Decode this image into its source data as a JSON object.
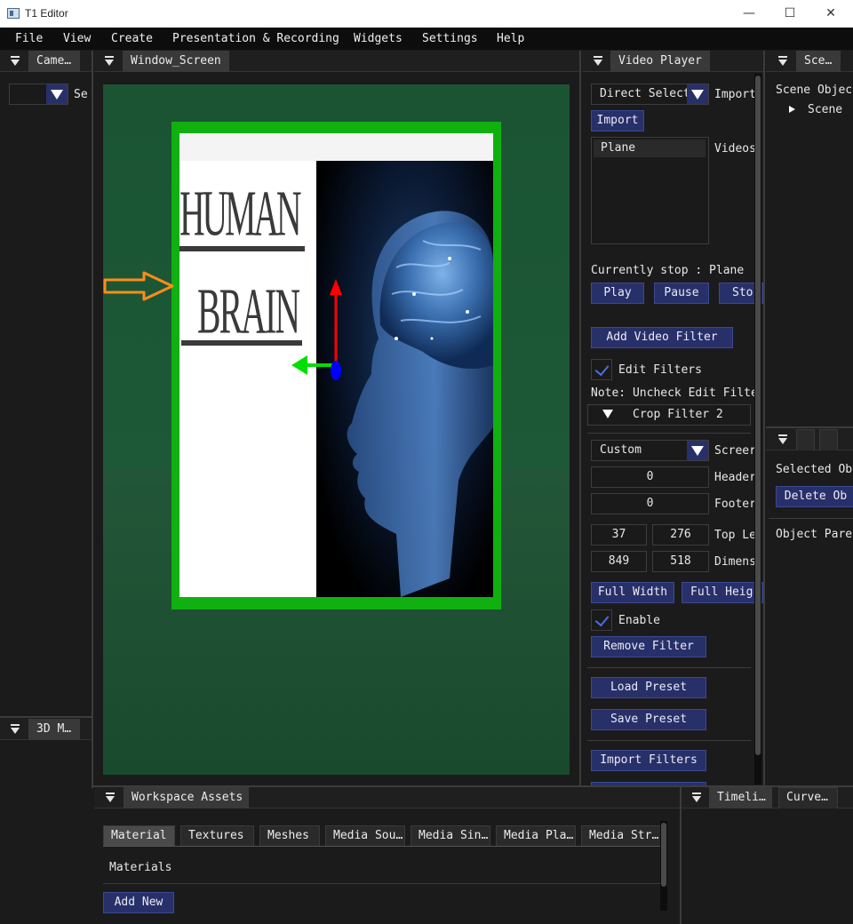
{
  "window": {
    "title": "T1 Editor",
    "minimize": "—",
    "maximize": "☐",
    "close": "✕"
  },
  "menu": [
    "File",
    "View",
    "Create",
    "Presentation & Recording",
    "Widgets",
    "Settings",
    "Help"
  ],
  "camera_panel": {
    "tab": "Came…",
    "combo_value": "",
    "label": "Se"
  },
  "model_panel": {
    "tab": "3D M…"
  },
  "viewport_panel": {
    "tab": "Window_Screen",
    "screen": {
      "title_word": "HUMAN",
      "subtitle_word": "BRAIN"
    }
  },
  "video_player": {
    "tab": "Video Player",
    "source_combo": "Direct Select",
    "import_label": "Import",
    "import_button": "Import",
    "list_items": [
      "Plane"
    ],
    "videos_label": "Videos",
    "status": "Currently stop : Plane",
    "play": "Play",
    "pause": "Pause",
    "stop": "Sto",
    "add_filter": "Add Video Filter",
    "edit_filters_label": "Edit Filters",
    "edit_filters_checked": true,
    "note": "Note: Uncheck Edit Filte",
    "filter_header": "Crop Filter 2",
    "screen_combo": "Custom",
    "screen_label": "Screer",
    "header_value": "0",
    "header_label": "Header",
    "footer_value": "0",
    "footer_label": "Footer",
    "top_left_x": "37",
    "top_left_y": "276",
    "top_left_label": "Top Le",
    "dim_w": "849",
    "dim_h": "518",
    "dim_label": "Dimens",
    "full_width": "Full Width",
    "full_height": "Full Heig",
    "enable_label": "Enable",
    "enable_checked": true,
    "remove_filter": "Remove Filter",
    "load_preset": "Load Preset",
    "save_preset": "Save Preset",
    "import_filters": "Import Filters"
  },
  "scene_panel": {
    "tab": "Sce…",
    "objects_label": "Scene Objec",
    "tree_item": "Scene"
  },
  "inspector_panel": {
    "selected_label": "Selected Ob",
    "delete_button": "Delete Ob",
    "parent_label": "Object Pare"
  },
  "assets_panel": {
    "tab": "Workspace Assets",
    "tabs": [
      "Material",
      "Textures",
      "Meshes",
      "Media Sou…",
      "Media Sin…",
      "Media Pla…",
      "Media Str…"
    ],
    "active_tab": "Material",
    "section_label": "Materials",
    "add_new": "Add New"
  },
  "timeline_panel": {
    "tabs": [
      "Timeli…",
      "Curve…"
    ]
  },
  "colors": {
    "accent_button": "#28306a",
    "gizmo_x": "#00e000",
    "gizmo_y": "#ff0000",
    "gizmo_z": "#0000ff",
    "frame": "#10b010",
    "arrow": "#ff8c1a"
  }
}
